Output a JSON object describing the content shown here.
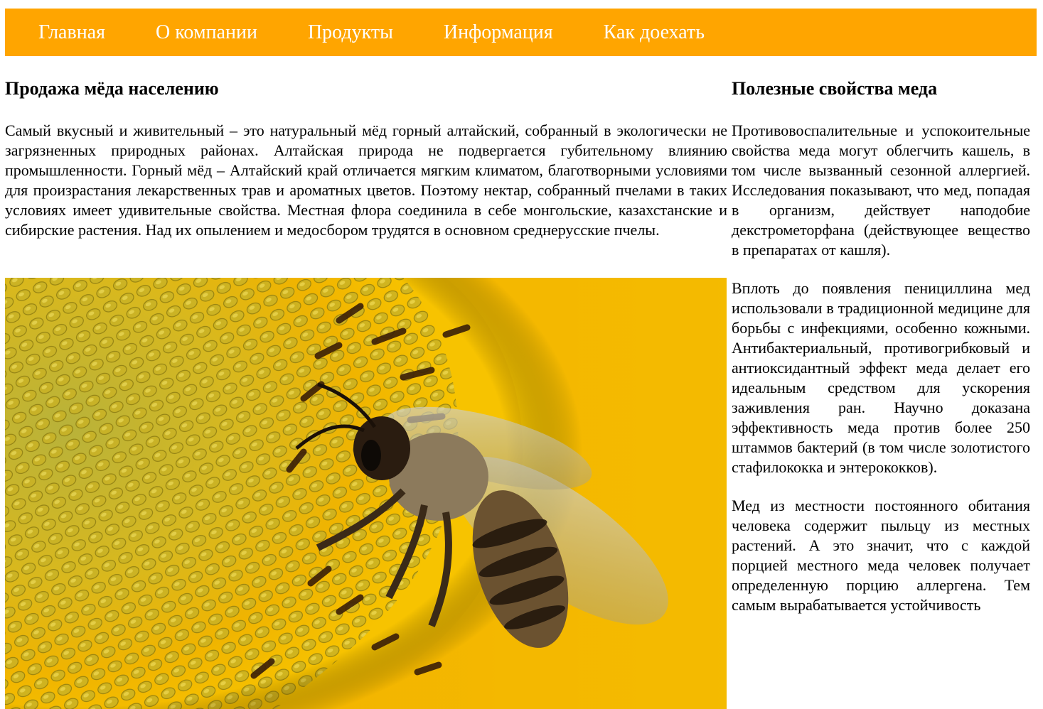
{
  "nav": {
    "items": [
      "Главная",
      "О компании",
      "Продукты",
      "Информация",
      "Как доехать"
    ]
  },
  "main": {
    "title": "Продажа мёда населению",
    "text": "Самый вкусный и живительный – это натуральный мёд горный алтайский, собранный в экологически не загрязненных природных районах. Алтайская природа не подвергается губительному влиянию промышленности. Горный мёд – Алтайский край отличается мягким климатом, благотворными условиями для произрастания лекарственных трав и ароматных цветов. Поэтому нектар, собранный пчелами в таких условиях имеет удивительные свойства. Местная флора соединила в себе монгольские, казахстанские и сибирские растения. Над их опылением и медосбором трудятся в основном среднерусские пчелы."
  },
  "side": {
    "title": "Полезные свойства меда",
    "paragraphs": [
      "Противовоспалительные и успокоительные свойства меда могут облегчить кашель, в том числе вызванный сезонной аллергией. Исследования показывают, что мед, попадая в организм, действует наподобие декстрометорфана (действующее вещество в препаратах от кашля).",
      "Вплоть до появления пенициллина мед использовали в традиционной медицине для борьбы с инфекциями, особенно кожными. Антибактериальный, противогрибковый и антиоксидантный эффект меда делает его идеальным средством для ускорения заживления ран. Научно доказана эффективность меда против более 250 штаммов бактерий (в том числе золотистого стафилококка и энтерококков).",
      "Мед из местности постоянного обитания человека содержит пыльцу из местных растений. А это значит, что с каждой порцией местного меда человек получает определенную порцию аллергена. Тем самым вырабатывается устойчивость"
    ]
  },
  "colors": {
    "nav_bg": "#ffa500",
    "nav_text": "#ffffff"
  },
  "image": {
    "subject": "bee-on-sunflower"
  }
}
